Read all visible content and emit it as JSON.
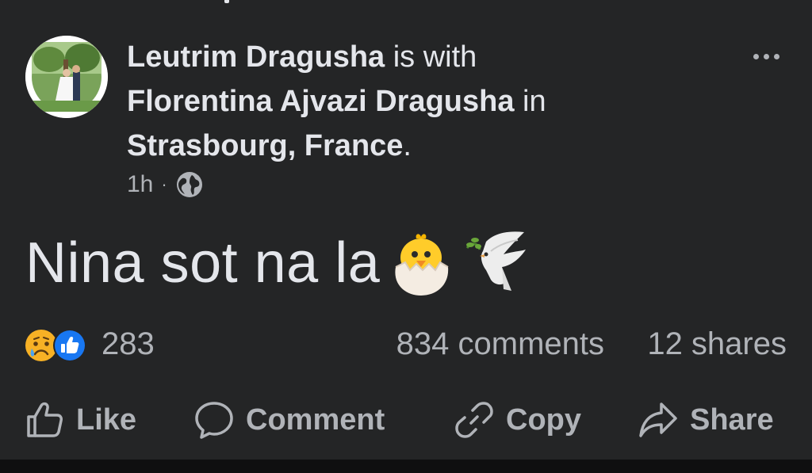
{
  "post": {
    "author": "Leutrim Dragusha",
    "with_text": " is with ",
    "tagged_person": "Florentina Ajvazi Dragusha",
    "in_text": " in ",
    "location": "Strasbourg, France",
    "period": ".",
    "time": "1h",
    "separator": "·",
    "privacy_icon": "globe-icon",
    "message": "Nina sot na la",
    "emojis": [
      "hatching-chick",
      "dove"
    ]
  },
  "stats": {
    "reactions": [
      "sad-reaction",
      "like-reaction"
    ],
    "reaction_count": "283",
    "comments": "834 comments",
    "shares": "12 shares"
  },
  "actions": {
    "like": "Like",
    "comment": "Comment",
    "copy": "Copy",
    "share": "Share"
  },
  "colors": {
    "background": "#242526",
    "primary_text": "#e4e6eb",
    "secondary_text": "#b0b3b8",
    "like_blue": "#1877f2"
  }
}
